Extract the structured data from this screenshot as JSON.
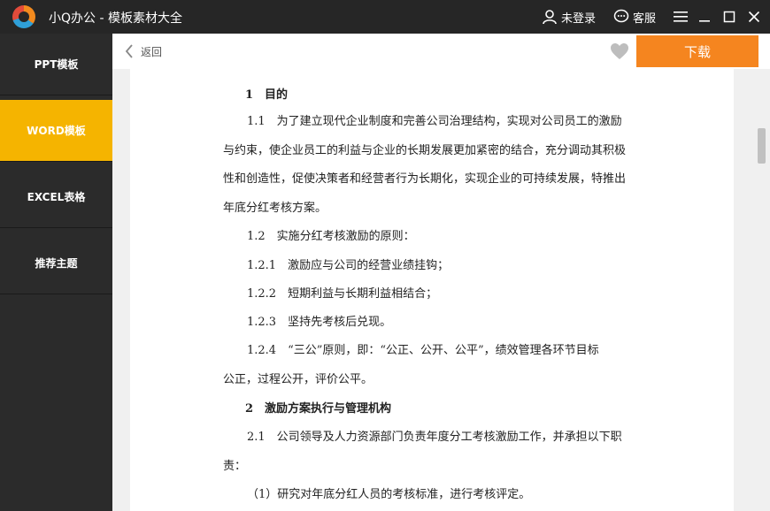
{
  "app": {
    "title": "小Q办公 - 模板素材大全"
  },
  "titlebar": {
    "login_label": "未登录",
    "service_label": "客服"
  },
  "sidebar": {
    "items": [
      {
        "label": "PPT模板",
        "active": false
      },
      {
        "label": "WORD模板",
        "active": true
      },
      {
        "label": "EXCEL表格",
        "active": false
      },
      {
        "label": "推荐主题",
        "active": false
      }
    ]
  },
  "toolbar": {
    "back_label": "返回",
    "download_label": "下载"
  },
  "colors": {
    "active_tab": "#f5b400",
    "download_button": "#f5851f",
    "titlebar": "#262626",
    "sidebar": "#2b2b2b"
  },
  "document": {
    "lines": [
      "1　目的",
      "1.1　为了建立现代企业制度和完善公司治理结构，实现对公司员工的激励",
      "与约束，使企业员工的利益与企业的长期发展更加紧密的结合，充分调动其积极",
      "性和创造性，促使决策者和经营者行为长期化，实现企业的可持续发展，特推出",
      "年底分红考核方案。",
      "1.2　实施分红考核激励的原则：",
      "1.2.1　激励应与公司的经营业绩挂钩；",
      "1.2.2　短期利益与长期利益相结合；",
      "1.2.3　坚持先考核后兑现。",
      "1.2.4　“三公”原则，即：“公正、公开、公平”，绩效管理各环节目标",
      "公正，过程公开，评价公平。",
      "2　激励方案执行与管理机构",
      "2.1　公司领导及人力资源部门负责年度分工考核激励工作，并承担以下职",
      "责：",
      "（1）研究对年底分红人员的考核标准，进行考核评定。"
    ]
  }
}
